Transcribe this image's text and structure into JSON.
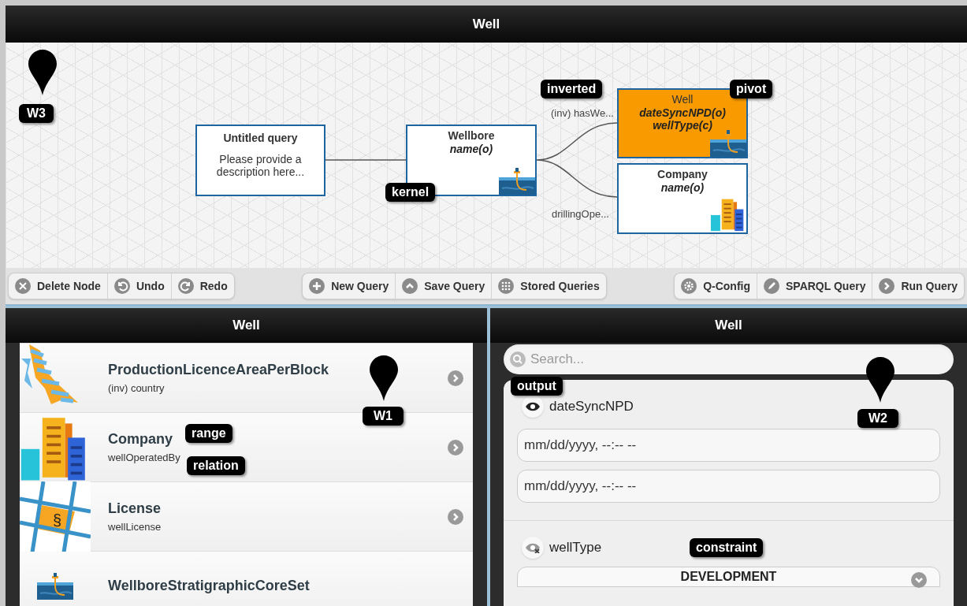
{
  "window": {
    "title": "Well"
  },
  "canvas": {
    "marker": {
      "label": "W3"
    },
    "nodes": [
      {
        "kind": "description",
        "title": "Untitled query",
        "lines": [
          "Please provide a description here..."
        ],
        "selected": false
      },
      {
        "kind": "well",
        "title": "Wellbore",
        "lines": [
          "name(o)"
        ],
        "selected": false,
        "tag": "kernel"
      },
      {
        "kind": "well",
        "title": "Well",
        "lines": [
          "dateSyncNPD(o)",
          "wellType(c)"
        ],
        "selected": true,
        "tag": "pivot"
      },
      {
        "kind": "company",
        "title": "Company",
        "lines": [
          "name(o)"
        ],
        "selected": false
      }
    ],
    "edges": [
      {
        "label": "(inv) hasWe...",
        "tag": "inverted"
      },
      {
        "label": "drillingOpe..."
      }
    ]
  },
  "toolbar": [
    [
      {
        "label": "Delete Node"
      },
      {
        "label": "Undo"
      },
      {
        "label": "Redo"
      }
    ],
    [
      {
        "label": "New Query"
      },
      {
        "label": "Save Query"
      },
      {
        "label": "Stored Queries"
      }
    ],
    [
      {
        "label": "Q-Config"
      },
      {
        "label": "SPARQL Query"
      },
      {
        "label": "Run Query"
      }
    ]
  ],
  "left_panel": {
    "title": "Well",
    "marker": {
      "label": "W1"
    },
    "items": [
      {
        "kind": "area",
        "title": "ProductionLicenceAreaPerBlock",
        "subtitle": "(inv) country"
      },
      {
        "kind": "company",
        "title": "Company",
        "subtitle": "wellOperatedBy",
        "tags": [
          "range",
          "relation"
        ]
      },
      {
        "kind": "license",
        "title": "License",
        "subtitle": "wellLicense",
        "icon_glyph": "§"
      },
      {
        "kind": "rig",
        "title": "WellboreStratigraphicCoreSet"
      }
    ]
  },
  "right_panel": {
    "title": "Well",
    "search": {
      "placeholder": "Search..."
    },
    "marker": {
      "label": "W2"
    },
    "properties": [
      {
        "kind": "datetime",
        "name": "dateSyncNPD",
        "visible": true,
        "tag": "output",
        "inputs": [
          {
            "placeholder": "mm/dd/yyyy, --:-- --"
          },
          {
            "placeholder": "mm/dd/yyyy, --:-- --"
          }
        ]
      },
      {
        "kind": "select",
        "name": "wellType",
        "visible": false,
        "tag": "constraint",
        "value": "DEVELOPMENT"
      }
    ]
  }
}
